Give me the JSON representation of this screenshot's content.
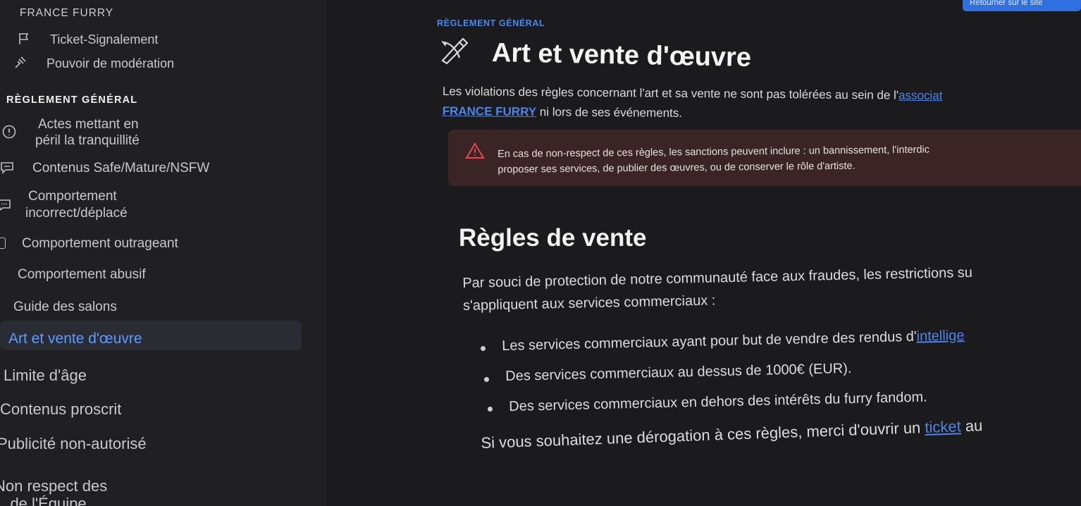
{
  "sidebar": {
    "section_title": "FRANCE FURRY",
    "top_items": [
      {
        "label": "Ticket-Signalement",
        "icon": "flag-icon"
      },
      {
        "label": "Pouvoir de modération",
        "icon": "gavel-icon"
      }
    ],
    "heading": "RÈGLEMENT GÉNÉRAL",
    "items": [
      {
        "label_line1": "Actes mettant en",
        "label_line2": "péril la tranquillité",
        "icon": "alert-circle-icon"
      },
      {
        "label": "Contenus Safe/Mature/NSFW",
        "icon": "chat-icon"
      },
      {
        "label_line1": "Comportement",
        "label_line2": "incorrect/déplacé",
        "icon": "message-icon"
      },
      {
        "label": "Comportement outrageant"
      },
      {
        "label": "Comportement abusif"
      },
      {
        "label": "Guide des salons"
      },
      {
        "label": "Art et vente d'œuvre",
        "active": true
      },
      {
        "label": "Limite d'âge"
      },
      {
        "label": "Contenus proscrit"
      },
      {
        "label": "Publicité non-autorisé"
      },
      {
        "label_line1": "Non respect des",
        "label_line2": "... de l'Équipe"
      }
    ]
  },
  "header": {
    "return_button": "Retourner sur le site",
    "breadcrumb": "RÈGLEMENT GÉNÉRAL"
  },
  "page": {
    "title": "Art et vente d'œuvre",
    "title_icon": "brush-pencil-icon",
    "intro_line1_pre": "Les violations des règles concernant l'art et sa vente ne sont pas tolérées au sein de l'",
    "intro_link1": "associat",
    "intro_link2": "FRANCE FURRY",
    "intro_line2_post": " ni lors de ses événements.",
    "alert": {
      "icon": "warning-triangle-icon",
      "line1": "En cas de non-respect de ces règles, les sanctions peuvent inclure : un bannissement, l'interdic",
      "line2": "proposer ses services, de publier des œuvres, ou de conserver le rôle d'artiste."
    },
    "section_title": "Règles de vente",
    "para_line1": "Par souci de protection de notre communauté face aux fraudes, les restrictions su",
    "para_line2": "s'appliquent aux services commerciaux :",
    "bullets": [
      {
        "text": "Les services commerciaux ayant pour but de vendre des rendus d'",
        "link": "intellige"
      },
      {
        "text": "Des services commerciaux au dessus de 1000€ (EUR)."
      },
      {
        "text": "Des services commerciaux en dehors des intérêts du furry fandom."
      }
    ],
    "final_pre": "Si vous souhaitez une dérogation à ces règles, merci d'ouvrir un ",
    "final_link": "ticket",
    "final_post": " au"
  },
  "colors": {
    "background": "#1b1b1d",
    "sidebar": "#202022",
    "accent": "#4d86e8",
    "active": "#5f9bff",
    "alert_bg": "#3a2426",
    "alert_icon": "#e5484d"
  }
}
